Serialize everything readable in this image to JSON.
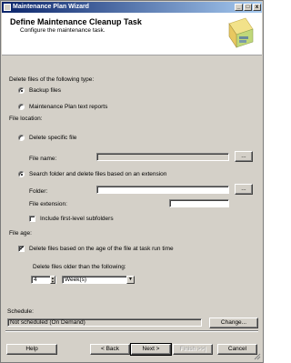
{
  "window": {
    "title": "Maintenance Plan Wizard",
    "minimize_glyph": "_",
    "maximize_glyph": "□",
    "close_glyph": "x"
  },
  "header": {
    "title": "Define Maintenance Cleanup Task",
    "subtitle": "Configure the maintenance task."
  },
  "delete_type": {
    "label": "Delete files of the following type:",
    "options": [
      {
        "label": "Backup files",
        "selected": true
      },
      {
        "label": "Maintenance Plan text reports",
        "selected": false
      }
    ]
  },
  "file_location": {
    "label": "File location:",
    "delete_specific": {
      "label": "Delete specific file",
      "selected": false
    },
    "file_name": {
      "label": "File name:",
      "value": "",
      "browse_label": "..."
    },
    "search_folder": {
      "label": "Search folder and delete files based on an extension",
      "selected": true
    },
    "folder": {
      "label": "Folder:",
      "value": "",
      "browse_label": "..."
    },
    "file_extension": {
      "label": "File extension:",
      "value": ""
    },
    "include_subfolders": {
      "label": "Include first-level subfolders",
      "checked": false
    }
  },
  "file_age": {
    "label": "File age:",
    "delete_based_on_age": {
      "label": "Delete files based on the age of the file at task run time",
      "checked": true
    },
    "older_than_label": "Delete files older than the following:",
    "amount": "4",
    "unit": "Week(s)",
    "check_glyph": "✓",
    "spin_up": "▲",
    "spin_down": "▼",
    "dropdown_arrow": "▼"
  },
  "schedule": {
    "label": "Schedule:",
    "value": "Not scheduled (On Demand)",
    "change_label": "Change..."
  },
  "footer": {
    "help_label": "Help",
    "back_label": "< Back",
    "next_label": "Next >",
    "finish_label": "Finish >>|",
    "cancel_label": "Cancel"
  },
  "colors": {
    "dialog": "#d4d0c8",
    "title_start": "#0a246a",
    "title_end": "#a6caf0"
  }
}
